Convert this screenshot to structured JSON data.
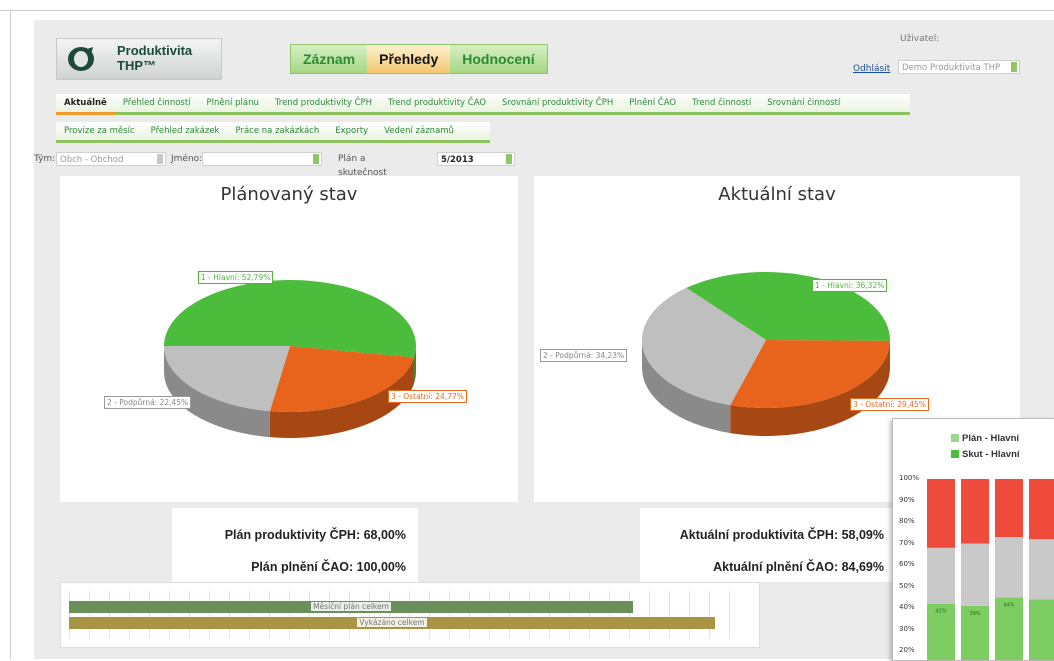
{
  "header": {
    "logo_text": "Produktivita\nTHP™",
    "tabs": [
      {
        "label": "Záznam",
        "active": false
      },
      {
        "label": "Přehledy",
        "active": true
      },
      {
        "label": "Hodnocení",
        "active": false
      }
    ],
    "user_label": "Uživatel:",
    "logout_label": "Odhlásit",
    "user_value": "Demo Produktivita THP"
  },
  "subnav_row1": [
    "Aktuálně",
    "Přehled činností",
    "Plnění plánu",
    "Trend produktivity ČPH",
    "Trend produktivity ČAO",
    "Srovnání produktivity ČPH",
    "Plnění ČAO",
    "Trend činností",
    "Srovnání činností"
  ],
  "subnav_row2": [
    "Provize za měsíc",
    "Přehled zakázek",
    "Práce na zakázkách",
    "Exporty",
    "Vedení záznamů"
  ],
  "filters": {
    "team_label": "Tým:",
    "team_value": "Obch - Obchod",
    "name_label": "Jméno:",
    "name_value": "",
    "period_label": "Plán a skutečnost za:",
    "period_value": "5/2013"
  },
  "pies": [
    {
      "title": "Plánovaný stav",
      "slices": [
        {
          "label": "1 - Hlavní: 52,79%",
          "value": 52.79,
          "color": "#4cbc3d"
        },
        {
          "label": "3 - Ostatní: 24,77%",
          "value": 24.77,
          "color": "#e8641c"
        },
        {
          "label": "2 - Podpůrná: 22,45%",
          "value": 22.45,
          "color": "#bfbfbf"
        }
      ]
    },
    {
      "title": "Aktuální stav",
      "slices": [
        {
          "label": "1 - Hlavní: 36,32%",
          "value": 36.32,
          "color": "#4cbc3d"
        },
        {
          "label": "3 - Ostatní: 29,45%",
          "value": 29.45,
          "color": "#e8641c"
        },
        {
          "label": "2 - Podpůrná: 34,23%",
          "value": 34.23,
          "color": "#bfbfbf"
        }
      ]
    }
  ],
  "stats": {
    "plan_cph": "Plán produktivity ČPH: 68,00%",
    "plan_cao": "Plán plnění ČAO: 100,00%",
    "actual_cph": "Aktuální produktivita ČPH: 58,09%",
    "actual_cao": "Aktuální plnění ČAO: 84,69%"
  },
  "progress_bars": [
    {
      "label": "Měsíční plán celkem",
      "fraction": 0.83,
      "color": "#6a8f5a"
    },
    {
      "label": "Vykázáno celkem",
      "fraction": 0.95,
      "color": "#a89544"
    }
  ],
  "mini_chart": {
    "legend": [
      {
        "label": "Plán - Hlavní",
        "color": "#9fd68b"
      },
      {
        "label": "Skut - Hlavní",
        "color": "#4cbc3d"
      }
    ],
    "yticks": [
      "100%",
      "90%",
      "80%",
      "70%",
      "60%",
      "50%",
      "40%",
      "30%",
      "20%"
    ],
    "bars": [
      {
        "green": 42,
        "grey": 26,
        "red": 32,
        "tag": "42%"
      },
      {
        "green": 41,
        "grey": 29,
        "red": 30,
        "tag": "39%"
      },
      {
        "green": 45,
        "grey": 28,
        "red": 27,
        "tag": "44%"
      },
      {
        "green": 44,
        "grey": 28,
        "red": 28,
        "tag": ""
      }
    ]
  }
}
